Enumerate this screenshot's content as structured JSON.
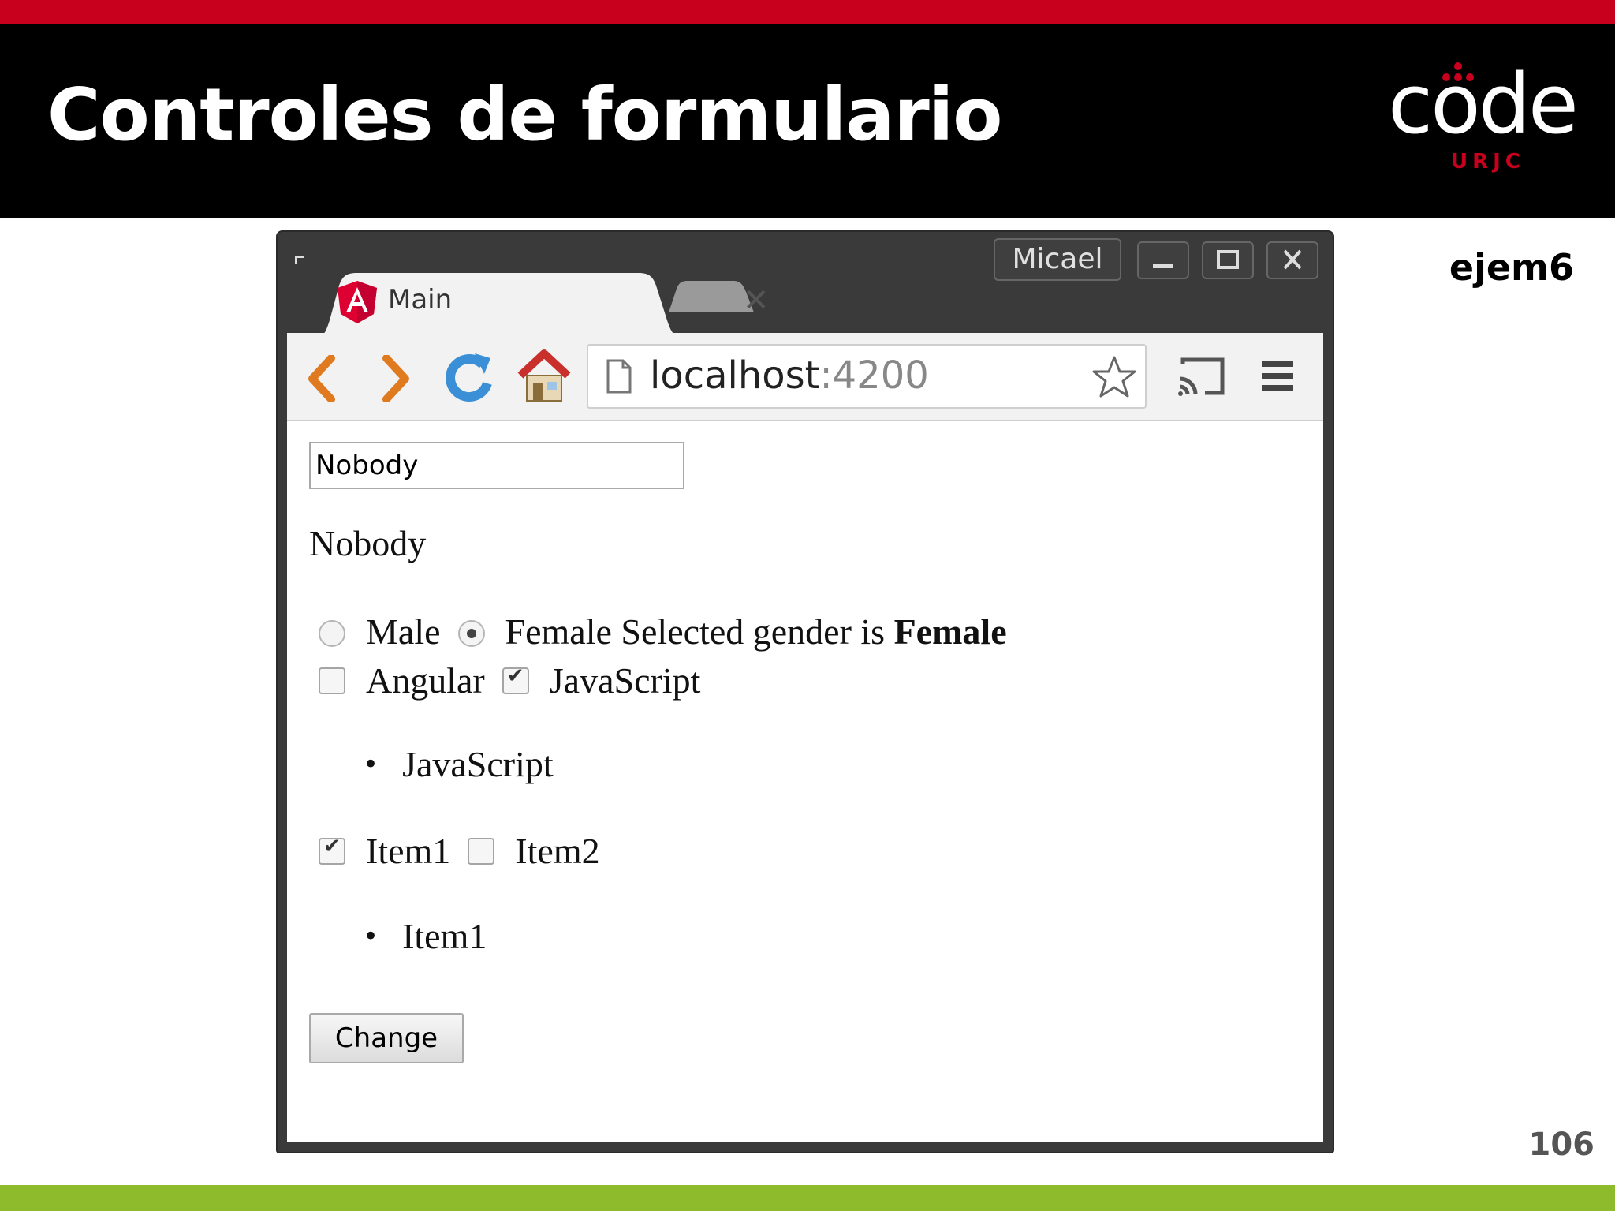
{
  "slide": {
    "title": "Controles de formulario",
    "logo_text": "code",
    "logo_sub": "URJC",
    "example_label": "ejem6",
    "page_number": "106"
  },
  "browser": {
    "user": "Micael",
    "tab_title": "Main",
    "url_host": "localhost",
    "url_port": ":4200"
  },
  "form": {
    "name_input_value": "Nobody",
    "name_echo": "Nobody",
    "gender_options": [
      "Male",
      "Female"
    ],
    "gender_selected": "Female",
    "gender_prefix": "Selected gender is",
    "gender_value": "Female",
    "tech_options": [
      "Angular",
      "JavaScript"
    ],
    "tech_checked": [
      false,
      true
    ],
    "tech_list": [
      "JavaScript"
    ],
    "item_options": [
      "Item1",
      "Item2"
    ],
    "item_checked": [
      true,
      false
    ],
    "item_list": [
      "Item1"
    ],
    "change_button": "Change"
  },
  "colors": {
    "header_red": "#c8001e",
    "header_black": "#000000",
    "footer_green": "#8dbb2b"
  }
}
